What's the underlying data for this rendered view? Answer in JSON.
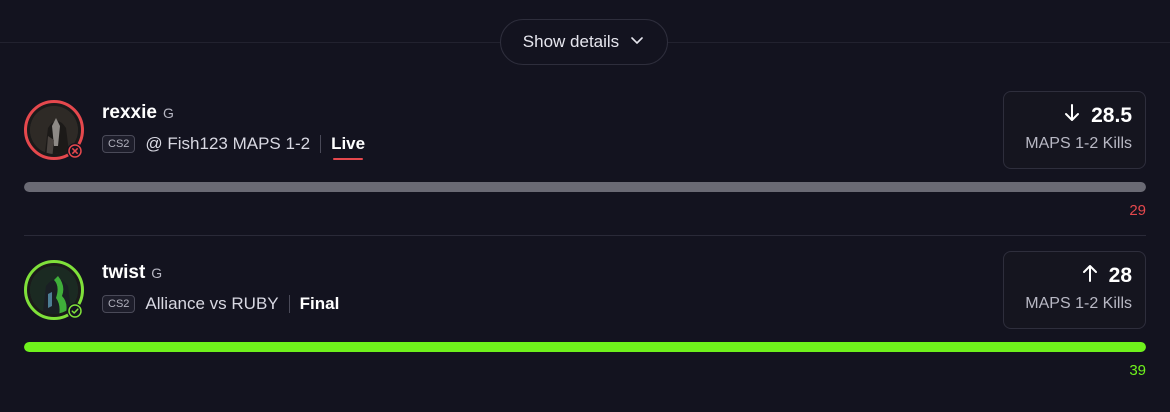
{
  "show_details": {
    "label": "Show details"
  },
  "projections": [
    {
      "player": "rexxie",
      "position": "G",
      "game": "CS2",
      "matchup": "@ Fish123 MAPS 1-2",
      "status": "Live",
      "result": "lost",
      "direction": "down",
      "line": "28.5",
      "stat_label": "MAPS 1-2 Kills",
      "actual": "29",
      "progress_fraction": 1.0,
      "colors": {
        "ring": "#e5484d",
        "bar": "#6a6a74",
        "value": "#e5484d"
      }
    },
    {
      "player": "twist",
      "position": "G",
      "game": "CS2",
      "matchup": "Alliance vs RUBY",
      "status": "Final",
      "result": "won",
      "direction": "up",
      "line": "28",
      "stat_label": "MAPS 1-2 Kills",
      "actual": "39",
      "progress_fraction": 1.0,
      "colors": {
        "ring": "#7fe03a",
        "bar": "#6ff21c",
        "value": "#6ff21c"
      }
    }
  ]
}
